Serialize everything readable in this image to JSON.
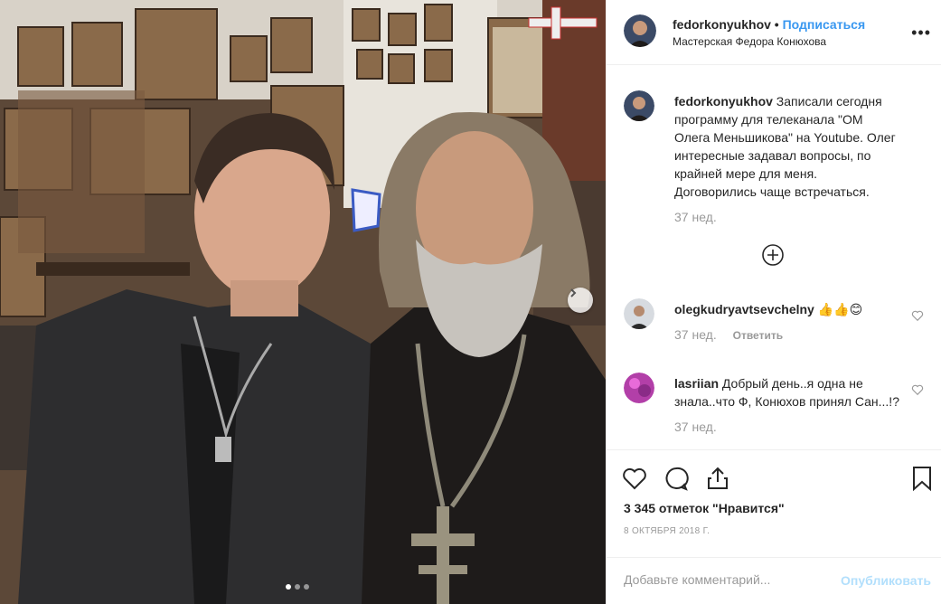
{
  "post": {
    "username": "fedorkonyukhov",
    "separator": "•",
    "follow_label": "Подписаться",
    "location": "Мастерская Федора Конюхова",
    "more_label": "•••"
  },
  "caption": {
    "username": "fedorkonyukhov",
    "text": "Записали сегодня программу для телеканала \"ОМ Олега Меньшикова\" на Youtube. Олег интересные задавал вопросы, по крайней мере для меня. Договорились чаще встречаться.",
    "time": "37 нед."
  },
  "comments": [
    {
      "username": "olegkudryavtsevchelny",
      "text": "👍👍😊",
      "time": "37 нед.",
      "reply_label": "Ответить"
    },
    {
      "username": "lasriian",
      "text": "Добрый день..я одна не знала..что Ф, Конюхов принял Сан...!?",
      "time": "37 нед."
    }
  ],
  "likes_text": "3 345 отметок \"Нравится\"",
  "date_text": "8 ОКТЯБРЯ 2018 Г.",
  "comment_box": {
    "placeholder": "Добавьте комментарий...",
    "publish_label": "Опубликовать"
  },
  "carousel": {
    "count": 3,
    "active_index": 0
  },
  "icons": [
    "chevron-right-icon",
    "plus-circle-icon",
    "heart-icon",
    "comment-icon",
    "share-icon",
    "bookmark-icon"
  ],
  "colors": {
    "accent": "#3897f0",
    "publish_disabled": "#b2dffc",
    "muted": "#999999"
  }
}
